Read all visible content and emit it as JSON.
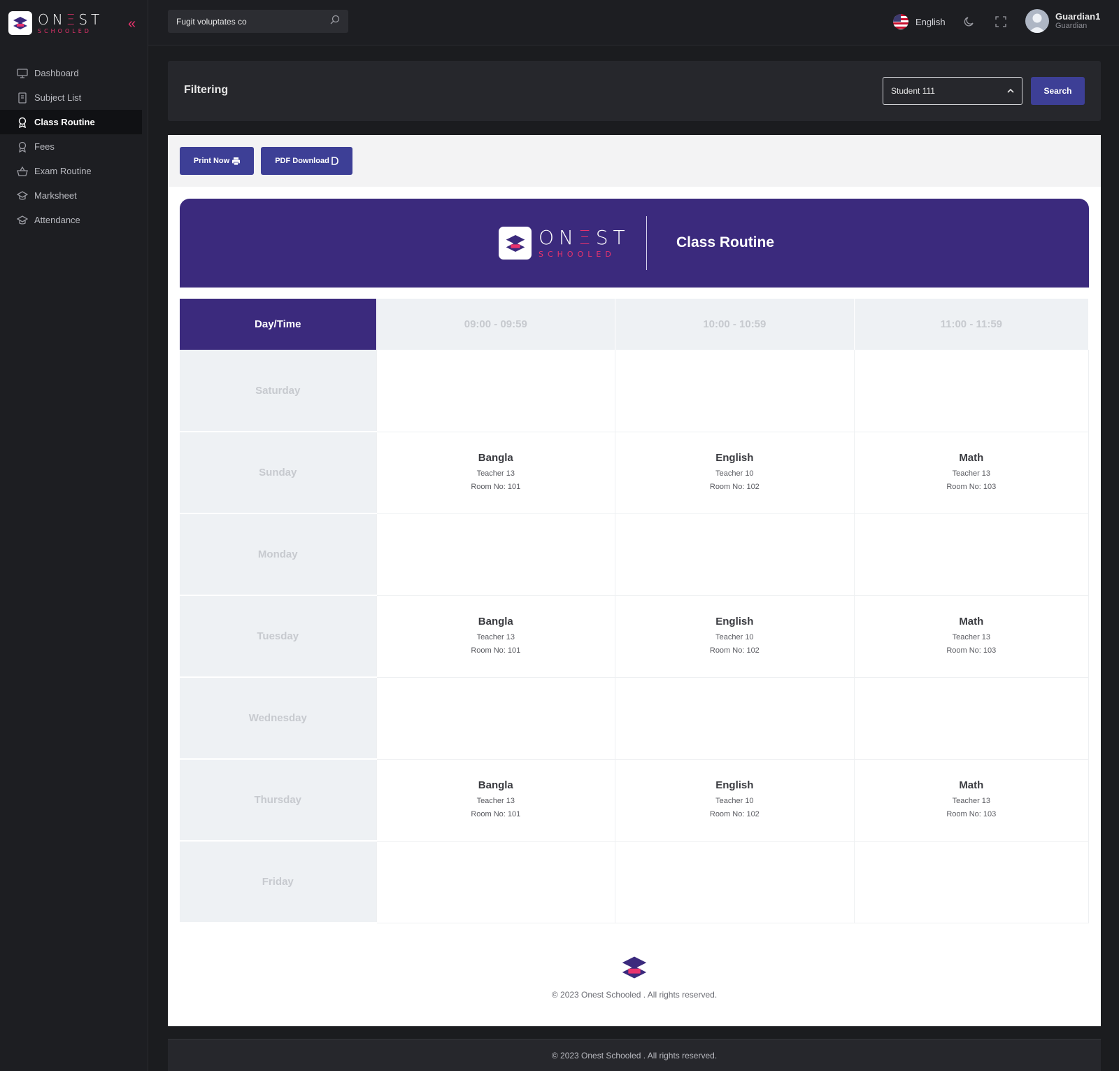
{
  "brand": {
    "main_left": "ON",
    "main_e": "Ξ",
    "main_right": "ST",
    "sub": "SCHOOLED"
  },
  "sidebar": {
    "items": [
      {
        "label": "Dashboard",
        "icon": "monitor-icon"
      },
      {
        "label": "Subject List",
        "icon": "book-icon"
      },
      {
        "label": "Class Routine",
        "icon": "award-icon",
        "active": true
      },
      {
        "label": "Fees",
        "icon": "award-icon"
      },
      {
        "label": "Exam Routine",
        "icon": "basket-icon"
      },
      {
        "label": "Marksheet",
        "icon": "graduation-cap-icon"
      },
      {
        "label": "Attendance",
        "icon": "graduation-cap-icon"
      }
    ]
  },
  "topbar": {
    "search_value": "Fugit voluptates co",
    "language": "English",
    "user_name": "Guardian1",
    "user_role": "Guardian"
  },
  "filter": {
    "title": "Filtering",
    "student_selected": "Student 111",
    "search_label": "Search"
  },
  "actions": {
    "print_label": "Print Now",
    "pdf_label": "PDF Download"
  },
  "routine": {
    "title": "Class Routine",
    "corner_header": "Day/Time",
    "time_slots": [
      "09:00 - 09:59",
      "10:00 - 10:59",
      "11:00 - 11:59"
    ],
    "days": [
      {
        "day": "Saturday",
        "classes": [
          null,
          null,
          null
        ]
      },
      {
        "day": "Sunday",
        "classes": [
          {
            "subject": "Bangla",
            "teacher": "Teacher 13",
            "room": "Room No: 101"
          },
          {
            "subject": "English",
            "teacher": "Teacher 10",
            "room": "Room No: 102"
          },
          {
            "subject": "Math",
            "teacher": "Teacher 13",
            "room": "Room No: 103"
          }
        ]
      },
      {
        "day": "Monday",
        "classes": [
          null,
          null,
          null
        ]
      },
      {
        "day": "Tuesday",
        "classes": [
          {
            "subject": "Bangla",
            "teacher": "Teacher 13",
            "room": "Room No: 101"
          },
          {
            "subject": "English",
            "teacher": "Teacher 10",
            "room": "Room No: 102"
          },
          {
            "subject": "Math",
            "teacher": "Teacher 13",
            "room": "Room No: 103"
          }
        ]
      },
      {
        "day": "Wednesday",
        "classes": [
          null,
          null,
          null
        ]
      },
      {
        "day": "Thursday",
        "classes": [
          {
            "subject": "Bangla",
            "teacher": "Teacher 13",
            "room": "Room No: 101"
          },
          {
            "subject": "English",
            "teacher": "Teacher 10",
            "room": "Room No: 102"
          },
          {
            "subject": "Math",
            "teacher": "Teacher 13",
            "room": "Room No: 103"
          }
        ]
      },
      {
        "day": "Friday",
        "classes": [
          null,
          null,
          null
        ]
      }
    ],
    "footer_text": "© 2023 Onest Schooled . All rights reserved."
  },
  "page_footer": "© 2023 Onest Schooled . All rights reserved.",
  "colors": {
    "accent": "#3d3f96",
    "brand_purple": "#3b2a7d",
    "brand_pink": "#e8336d"
  }
}
